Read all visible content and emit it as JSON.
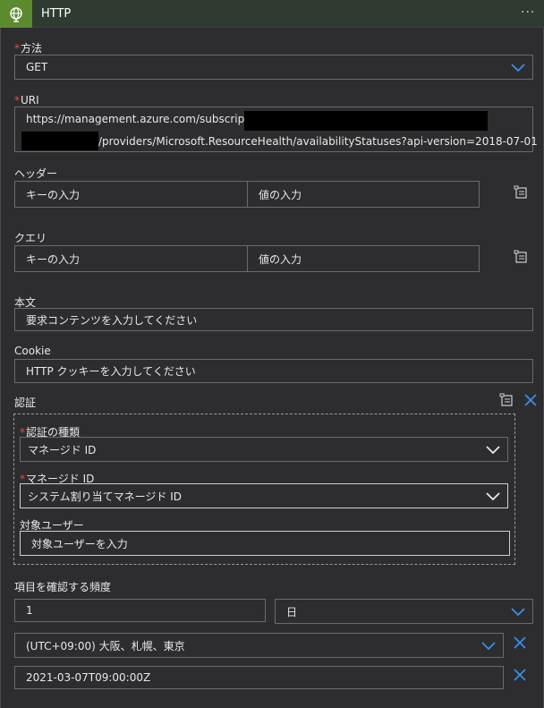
{
  "header": {
    "title": "HTTP",
    "more_label": "···",
    "icon": "globe-icon"
  },
  "method": {
    "label": "方法",
    "required_mark": "*",
    "value": "GET"
  },
  "uri": {
    "label": "URI",
    "required_mark": "*",
    "line1": "https://management.azure.com/subscriptions/",
    "line2": "/providers/Microsoft.ResourceHealth/availabilityStatuses?api-version=2018-07-01"
  },
  "headers": {
    "label": "ヘッダー",
    "key_placeholder": "キーの入力",
    "value_placeholder": "値の入力"
  },
  "query": {
    "label": "クエリ",
    "key_placeholder": "キーの入力",
    "value_placeholder": "値の入力"
  },
  "body": {
    "label": "本文",
    "placeholder": "要求コンテンツを入力してください"
  },
  "cookie": {
    "label": "Cookie",
    "placeholder": "HTTP クッキーを入力してください"
  },
  "auth": {
    "label": "認証",
    "type_label": "認証の種類",
    "type_required_mark": "*",
    "type_value": "マネージド ID",
    "identity_label": "マネージド ID",
    "identity_required_mark": "*",
    "identity_value": "システム割り当てマネージド ID",
    "audience_label": "対象ユーザー",
    "audience_placeholder": "対象ユーザーを入力"
  },
  "recurrence": {
    "label": "項目を確認する頻度",
    "interval": "1",
    "frequency": "日",
    "timezone": "(UTC+09:00) 大阪、札幌、東京",
    "start_time": "2021-03-07T09:00:00Z"
  },
  "colors": {
    "accent": "#3c8ee8",
    "required": "#e04b4b",
    "header_icon_bg": "#5c8a2f"
  }
}
